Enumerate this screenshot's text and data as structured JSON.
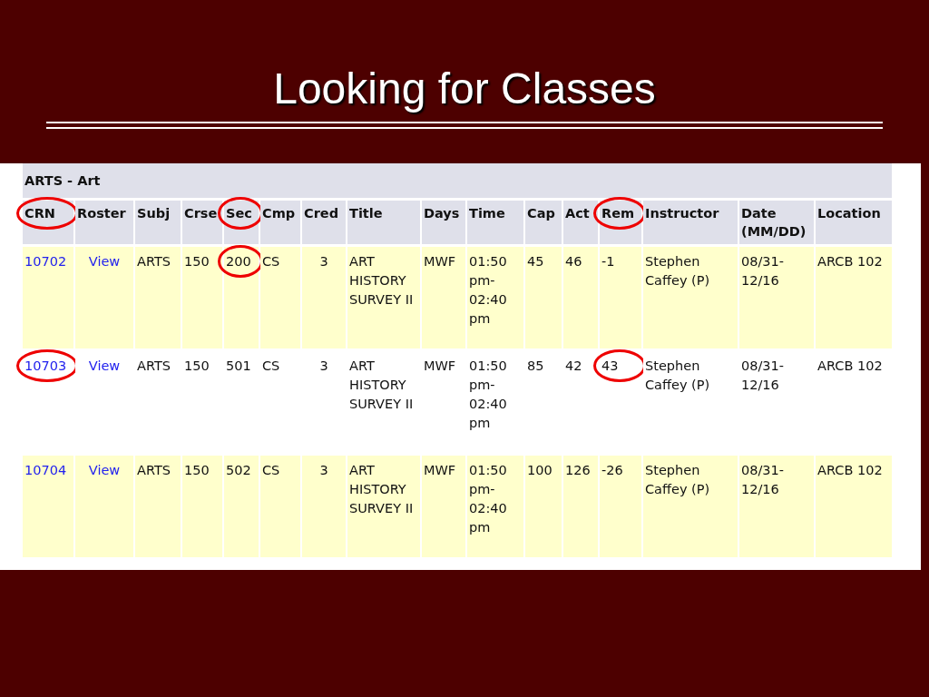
{
  "slide": {
    "title": "Looking for Classes"
  },
  "table": {
    "subject_heading": "ARTS - Art",
    "columns": [
      {
        "label": "CRN",
        "kind": "link",
        "circled": true
      },
      {
        "label": "Roster",
        "kind": "link",
        "circled": false
      },
      {
        "label": "Subj",
        "kind": "text",
        "circled": false
      },
      {
        "label": "Crse",
        "kind": "text",
        "circled": false
      },
      {
        "label": "Sec",
        "kind": "text",
        "circled": true
      },
      {
        "label": "Cmp",
        "kind": "text",
        "circled": false
      },
      {
        "label": "Cred",
        "kind": "number",
        "circled": false
      },
      {
        "label": "Title",
        "kind": "text",
        "circled": false
      },
      {
        "label": "Days",
        "kind": "text",
        "circled": false
      },
      {
        "label": "Time",
        "kind": "text",
        "circled": false
      },
      {
        "label": "Cap",
        "kind": "text",
        "circled": false
      },
      {
        "label": "Act",
        "kind": "text",
        "circled": false
      },
      {
        "label": "Rem",
        "kind": "text",
        "circled": true
      },
      {
        "label": "Instructor",
        "kind": "text",
        "circled": false
      },
      {
        "label": "Date (MM/DD)",
        "kind": "text",
        "circled": false
      },
      {
        "label": "Location",
        "kind": "text",
        "circled": false
      }
    ],
    "rows": [
      {
        "shaded": true,
        "cells": [
          {
            "text": "10702",
            "circled": false
          },
          {
            "text": "View",
            "circled": false
          },
          {
            "text": "ARTS",
            "circled": false
          },
          {
            "text": "150",
            "circled": false
          },
          {
            "text": "200",
            "circled": true
          },
          {
            "text": "CS",
            "circled": false
          },
          {
            "text": "3",
            "circled": false
          },
          {
            "text": "ART HISTORY SURVEY II",
            "circled": false
          },
          {
            "text": "MWF",
            "circled": false
          },
          {
            "text": "01:50 pm-02:40 pm",
            "circled": false
          },
          {
            "text": "45",
            "circled": false
          },
          {
            "text": "46",
            "circled": false
          },
          {
            "text": "-1",
            "circled": false
          },
          {
            "text": "Stephen Caffey (P)",
            "circled": false
          },
          {
            "text": "08/31-12/16",
            "circled": false
          },
          {
            "text": "ARCB 102",
            "circled": false
          }
        ]
      },
      {
        "shaded": false,
        "cells": [
          {
            "text": "10703",
            "circled": true
          },
          {
            "text": "View",
            "circled": false
          },
          {
            "text": "ARTS",
            "circled": false
          },
          {
            "text": "150",
            "circled": false
          },
          {
            "text": "501",
            "circled": false
          },
          {
            "text": "CS",
            "circled": false
          },
          {
            "text": "3",
            "circled": false
          },
          {
            "text": "ART HISTORY SURVEY II",
            "circled": false
          },
          {
            "text": "MWF",
            "circled": false
          },
          {
            "text": "01:50 pm-02:40 pm",
            "circled": false
          },
          {
            "text": "85",
            "circled": false
          },
          {
            "text": "42",
            "circled": false
          },
          {
            "text": "43",
            "circled": true
          },
          {
            "text": "Stephen Caffey (P)",
            "circled": false
          },
          {
            "text": "08/31-12/16",
            "circled": false
          },
          {
            "text": "ARCB 102",
            "circled": false
          }
        ]
      },
      {
        "shaded": true,
        "cells": [
          {
            "text": "10704",
            "circled": false
          },
          {
            "text": "View",
            "circled": false
          },
          {
            "text": "ARTS",
            "circled": false
          },
          {
            "text": "150",
            "circled": false
          },
          {
            "text": "502",
            "circled": false
          },
          {
            "text": "CS",
            "circled": false
          },
          {
            "text": "3",
            "circled": false
          },
          {
            "text": "ART HISTORY SURVEY II",
            "circled": false
          },
          {
            "text": "MWF",
            "circled": false
          },
          {
            "text": "01:50 pm-02:40 pm",
            "circled": false
          },
          {
            "text": "100",
            "circled": false
          },
          {
            "text": "126",
            "circled": false
          },
          {
            "text": "-26",
            "circled": false
          },
          {
            "text": "Stephen Caffey (P)",
            "circled": false
          },
          {
            "text": "08/31-12/16",
            "circled": false
          },
          {
            "text": "ARCB 102",
            "circled": false
          }
        ]
      }
    ]
  }
}
